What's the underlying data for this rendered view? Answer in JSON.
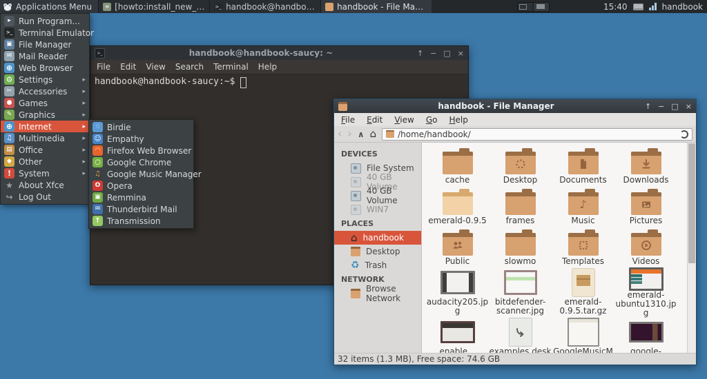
{
  "colors": {
    "desktop": "#3c78a8",
    "panel": "#24282b",
    "accent": "#d8553c",
    "folder": "#d7a170"
  },
  "panel": {
    "applications_menu": "Applications Menu",
    "tasks": [
      {
        "label": "[howto:install_new_the...",
        "icon": "editor",
        "active": false
      },
      {
        "label": "handbook@handbook-s...",
        "icon": "terminal",
        "active": false
      },
      {
        "label": "handbook - File Manager",
        "icon": "folder",
        "active": true
      }
    ],
    "clock": "15:40",
    "user": "handbook"
  },
  "apps_menu": {
    "items": [
      {
        "label": "Run Program...",
        "icon": "run"
      },
      {
        "label": "Terminal Emulator",
        "icon": "terminal"
      },
      {
        "label": "File Manager",
        "icon": "files"
      },
      {
        "label": "Mail Reader",
        "icon": "mail"
      },
      {
        "label": "Web Browser",
        "icon": "web"
      },
      {
        "label": "Settings",
        "icon": "settings",
        "arrow": true
      },
      {
        "label": "Accessories",
        "icon": "accessories",
        "arrow": true
      },
      {
        "label": "Games",
        "icon": "games",
        "arrow": true
      },
      {
        "label": "Graphics",
        "icon": "graphics",
        "arrow": true
      },
      {
        "label": "Internet",
        "icon": "internet",
        "arrow": true,
        "selected": true
      },
      {
        "label": "Multimedia",
        "icon": "multimedia",
        "arrow": true
      },
      {
        "label": "Office",
        "icon": "office",
        "arrow": true
      },
      {
        "label": "Other",
        "icon": "other",
        "arrow": true
      },
      {
        "label": "System",
        "icon": "system",
        "arrow": true
      },
      {
        "label": "About Xfce",
        "icon": "about"
      },
      {
        "label": "Log Out",
        "icon": "logout"
      }
    ]
  },
  "internet_submenu": {
    "items": [
      {
        "label": "Birdie",
        "icon": "birdie"
      },
      {
        "label": "Empathy",
        "icon": "empathy"
      },
      {
        "label": "Firefox Web Browser",
        "icon": "firefox"
      },
      {
        "label": "Google Chrome",
        "icon": "chrome"
      },
      {
        "label": "Google Music Manager",
        "icon": "gmm"
      },
      {
        "label": "Opera",
        "icon": "opera"
      },
      {
        "label": "Remmina",
        "icon": "remmina"
      },
      {
        "label": "Thunderbird Mail",
        "icon": "thunderbird"
      },
      {
        "label": "Transmission",
        "icon": "transmission"
      }
    ]
  },
  "terminal": {
    "title": "handbook@handbook-saucy: ~",
    "menu": [
      "File",
      "Edit",
      "View",
      "Search",
      "Terminal",
      "Help"
    ],
    "prompt": "handbook@handbook-saucy:~$",
    "controls": [
      "↑",
      "−",
      "□",
      "×"
    ]
  },
  "file_manager": {
    "title": "handbook - File Manager",
    "menu": [
      "File",
      "Edit",
      "View",
      "Go",
      "Help"
    ],
    "path": "/home/handbook/",
    "controls": [
      "↑",
      "−",
      "□",
      "×"
    ],
    "sidebar": [
      {
        "header": "DEVICES",
        "items": [
          {
            "label": "File System",
            "icon": "drive"
          },
          {
            "label": "40 GB Volume",
            "icon": "drive",
            "dim": true
          },
          {
            "label": "40 GB Volume",
            "icon": "drive"
          },
          {
            "label": "WIN7",
            "icon": "drive",
            "dim": true
          }
        ]
      },
      {
        "header": "PLACES",
        "items": [
          {
            "label": "handbook",
            "icon": "home",
            "selected": true
          },
          {
            "label": "Desktop",
            "icon": "folder"
          },
          {
            "label": "Trash",
            "icon": "trash"
          }
        ]
      },
      {
        "header": "NETWORK",
        "items": [
          {
            "label": "Browse Network",
            "icon": "network"
          }
        ]
      }
    ],
    "grid": [
      {
        "label": "cache",
        "icon": "folder"
      },
      {
        "label": "Desktop",
        "icon": "folder",
        "emblem": "desktop"
      },
      {
        "label": "Documents",
        "icon": "folder",
        "emblem": "documents"
      },
      {
        "label": "Downloads",
        "icon": "folder",
        "emblem": "downloads"
      },
      {
        "label": "emerald-0.9.5",
        "icon": "folder-light"
      },
      {
        "label": "frames",
        "icon": "folder"
      },
      {
        "label": "Music",
        "icon": "folder",
        "emblem": "music"
      },
      {
        "label": "Pictures",
        "icon": "folder",
        "emblem": "pictures"
      },
      {
        "label": "Public",
        "icon": "folder",
        "emblem": "public"
      },
      {
        "label": "slowmo",
        "icon": "folder"
      },
      {
        "label": "Templates",
        "icon": "folder",
        "emblem": "templates"
      },
      {
        "label": "Videos",
        "icon": "folder",
        "emblem": "videos"
      },
      {
        "label": "audacity205.jpg",
        "icon": "thumb-audacity"
      },
      {
        "label": "bitdefender-scanner.jpg",
        "icon": "thumb-bitdefender"
      },
      {
        "label": "emerald-0.9.5.tar.gz",
        "icon": "archive"
      },
      {
        "label": "emerald-ubuntu1310.jpg",
        "icon": "thumb-emerald"
      },
      {
        "label": "enable...",
        "icon": "thumb-dark2"
      },
      {
        "label": "examples.deskto...",
        "icon": "desktop-file"
      },
      {
        "label": "GoogleMusicMan...",
        "icon": "thumb-white"
      },
      {
        "label": "google-search...",
        "icon": "thumb-purple"
      }
    ],
    "statusbar": "32 items (1.3 MB), Free space: 74.6 GB"
  }
}
